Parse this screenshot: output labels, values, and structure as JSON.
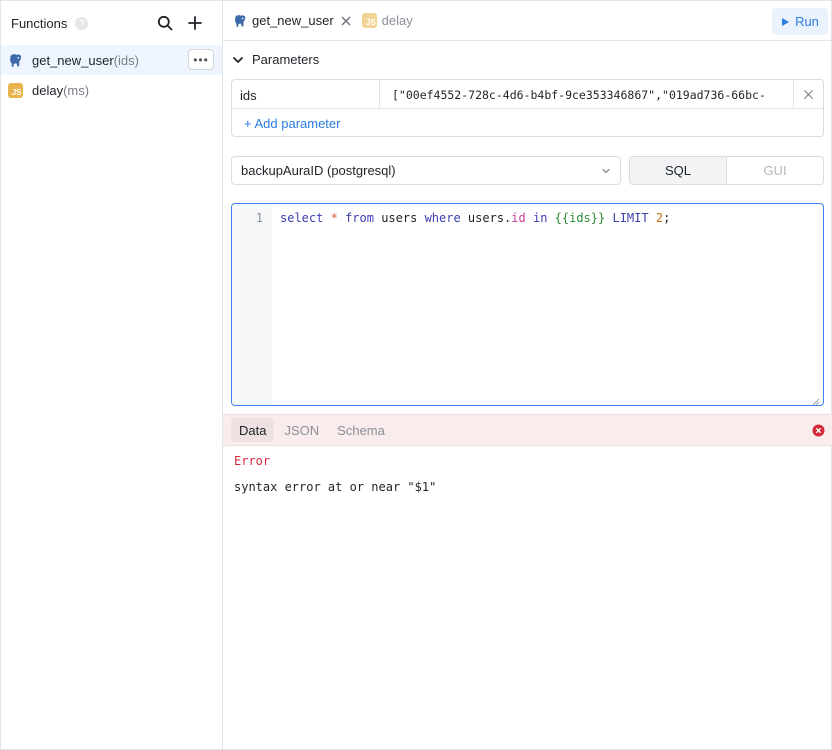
{
  "sidebar": {
    "title": "Functions",
    "items": [
      {
        "name": "get_new_user",
        "args": "(ids)",
        "lang": "postgres-icon",
        "active": true
      },
      {
        "name": "delay",
        "args": "(ms)",
        "lang": "js-icon",
        "active": false
      }
    ]
  },
  "tabs": [
    {
      "label": "get_new_user",
      "lang": "postgres-icon"
    },
    {
      "label": "delay",
      "lang": "js-icon"
    }
  ],
  "run_label": "Run",
  "js_badge": "JS",
  "parameters": {
    "title": "Parameters",
    "rows": [
      {
        "name": "ids",
        "value": "[\"00ef4552-728c-4d6-b4bf-9ce353346867\",\"019ad736-66bc-"
      }
    ],
    "add_label": "+ Add parameter"
  },
  "datasource": {
    "selected": "backupAuraID (postgresql)"
  },
  "mode": {
    "options": [
      "SQL",
      "GUI"
    ],
    "selected": "SQL"
  },
  "editor": {
    "line_number": "1",
    "tokens": {
      "select": "select",
      "star": "*",
      "from": "from",
      "users": "users",
      "where": "where",
      "users_obj": "users",
      "dot": ".",
      "id": "id",
      "in": "in",
      "tmpl": "{{ids}}",
      "limit": "LIMIT",
      "two": "2",
      "semi": ";"
    }
  },
  "results": {
    "tabs": [
      "Data",
      "JSON",
      "Schema"
    ],
    "selected": "Data",
    "error_title": "Error",
    "error_message": "syntax error at or near \"$1\""
  },
  "colors": {
    "accent": "#2b7de0",
    "error": "#d12b3b",
    "js": "#e8b34a"
  }
}
